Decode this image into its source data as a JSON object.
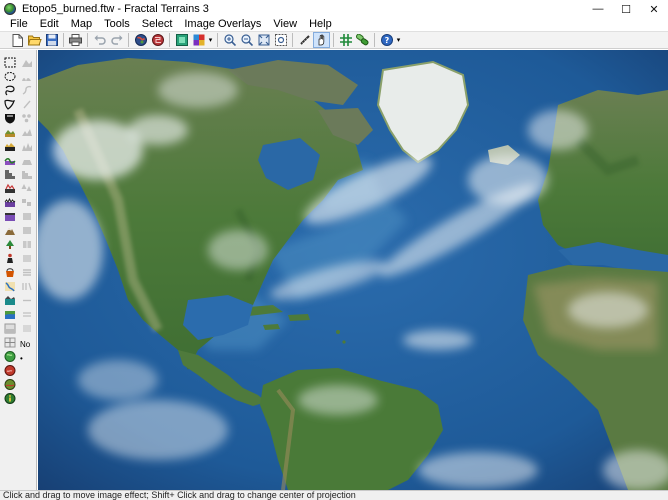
{
  "window": {
    "title": "Etopo5_burned.ftw - Fractal Terrains 3",
    "minimize": "—",
    "maximize": "☐",
    "close": "✕"
  },
  "menu": [
    "File",
    "Edit",
    "Map",
    "Tools",
    "Select",
    "Image Overlays",
    "View",
    "Help"
  ],
  "toolbar": {
    "buttons": [
      "new-icon",
      "open-icon",
      "save-icon",
      "print-icon",
      "undo-icon",
      "redo-icon",
      "globe-icon",
      "world-icon",
      "layer-icon",
      "palette-icon",
      "zoom-in-icon",
      "zoom-out-icon",
      "zoom-fit-icon",
      "zoom-window-icon",
      "measure-icon",
      "hand-icon",
      "grid-icon",
      "link-icon",
      "help-icon"
    ],
    "active": "hand-icon"
  },
  "left_panel": {
    "no_label": "No",
    "dot_label": "•"
  },
  "status": {
    "text": "Click and drag to move image effect; Shift+ Click and drag to change center of projection"
  },
  "colors": {
    "ocean": "#1e5a98",
    "land": "#4f7a3c",
    "ice": "#e8ecea",
    "active_tool": "#cfe3fb"
  }
}
